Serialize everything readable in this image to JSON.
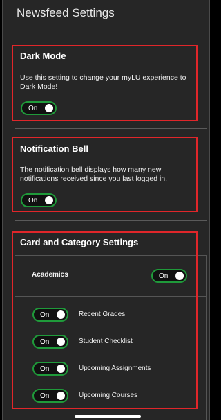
{
  "header": {
    "title": "Newsfeed Settings"
  },
  "dark_mode": {
    "title": "Dark Mode",
    "description": "Use this setting to change your myLU experience to Dark Mode!",
    "toggle_label": "On"
  },
  "notification_bell": {
    "title": "Notification Bell",
    "description": "The notification bell displays how many new notifications received since you last logged in.",
    "toggle_label": "On"
  },
  "cards": {
    "title": "Card and Category Settings",
    "academics": {
      "label": "Academics",
      "toggle_label": "On"
    },
    "items": [
      {
        "label": "Recent Grades",
        "toggle_label": "On"
      },
      {
        "label": "Student Checklist",
        "toggle_label": "On"
      },
      {
        "label": "Upcoming Assignments",
        "toggle_label": "On"
      },
      {
        "label": "Upcoming Courses",
        "toggle_label": "On"
      }
    ]
  },
  "colors": {
    "highlight": "#e0262a",
    "toggle_on": "#1f9a3a",
    "background": "#262626"
  }
}
